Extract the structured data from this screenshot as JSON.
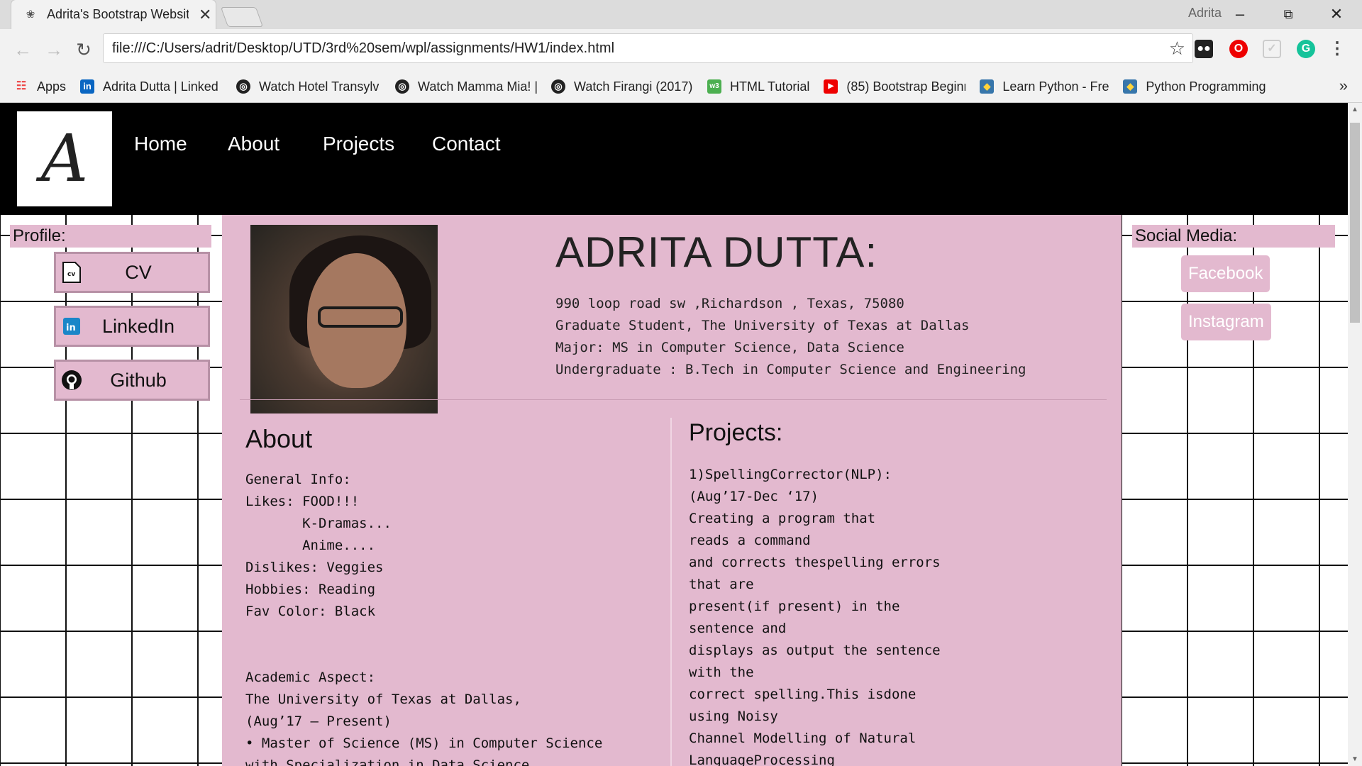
{
  "browser": {
    "tab_title": "Adrita's Bootstrap Websit",
    "user": "Adrita",
    "url": "file:///C:/Users/adrit/Desktop/UTD/3rd%20sem/wpl/assignments/HW1/index.html",
    "bookmarks": [
      {
        "label": "Apps"
      },
      {
        "label": "Adrita Dutta | Linked"
      },
      {
        "label": "Watch Hotel Transylv"
      },
      {
        "label": "Watch Mamma Mia! |"
      },
      {
        "label": "Watch Firangi (2017)"
      },
      {
        "label": "HTML Tutorial"
      },
      {
        "label": "(85) Bootstrap Beginr"
      },
      {
        "label": "Learn Python - Free I"
      },
      {
        "label": "Python Programming"
      }
    ],
    "more": "»"
  },
  "nav": {
    "logo": "A",
    "links": [
      "Home",
      "About",
      "Projects",
      "Contact"
    ]
  },
  "profile": {
    "heading": "Profile:",
    "items": [
      {
        "label": "CV",
        "icon": "cv-icon"
      },
      {
        "label": "LinkedIn",
        "icon": "linkedin-icon"
      },
      {
        "label": "Github",
        "icon": "github-icon"
      }
    ]
  },
  "social": {
    "heading": "Social Media:",
    "items": [
      "Facebook",
      "Instagram"
    ]
  },
  "header": {
    "name": "ADRITA DUTTA:",
    "info": "990 loop road sw ,Richardson , Texas, 75080\nGraduate Student, The University of Texas at Dallas\nMajor: MS in Computer Science, Data Science\nUndergraduate : B.Tech in Computer Science and Engineering"
  },
  "about": {
    "heading": "About",
    "body": "General Info:\nLikes: FOOD!!!\n       K-Dramas...\n       Anime....\nDislikes: Veggies\nHobbies: Reading\nFav Color: Black\n\n\nAcademic Aspect:\nThe University of Texas at Dallas,\n(Aug’17 – Present)\n• Master of Science (MS) in Computer Science\nwith Specialization in Data Science"
  },
  "projects": {
    "heading": "Projects:",
    "body": "1)SpellingCorrector(NLP):\n(Aug’17-Dec ‘17)\nCreating a program that\nreads a command\nand corrects thespelling errors\nthat are\npresent(if present) in the\nsentence and\ndisplays as output the sentence\nwith the\ncorrect spelling.This isdone\nusing Noisy\nChannel Modelling of Natural\nLanguageProcessing"
  },
  "colors": {
    "panel": "#e3b9cf",
    "navbar": "#000000"
  }
}
